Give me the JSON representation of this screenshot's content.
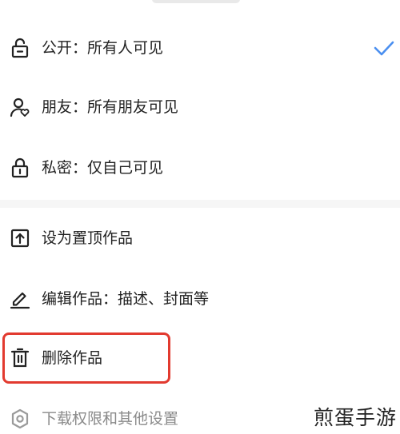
{
  "visibility": {
    "options": [
      {
        "label": "公开：所有人可见",
        "selected": true
      },
      {
        "label": "朋友：所有朋友可见",
        "selected": false
      },
      {
        "label": "私密：仅自己可见",
        "selected": false
      }
    ]
  },
  "actions": [
    {
      "label": "设为置顶作品"
    },
    {
      "label": "编辑作品：描述、封面等"
    },
    {
      "label": "删除作品"
    },
    {
      "label": "下载权限和其他设置"
    }
  ],
  "watermark": "煎蛋手游",
  "colors": {
    "accent_check": "#4a8ff0",
    "highlight": "#e23a2f",
    "text": "#222222",
    "muted": "#8a8a8a"
  }
}
